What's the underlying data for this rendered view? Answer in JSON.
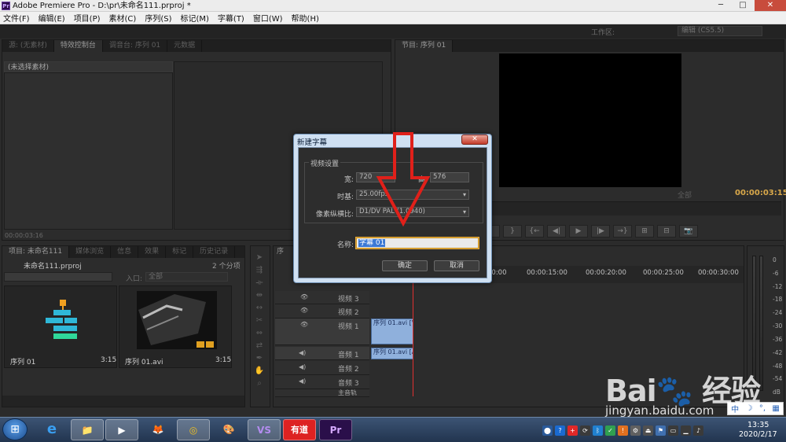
{
  "window": {
    "title": "Adobe Premiere Pro - D:\\pr\\未命名111.prproj *",
    "app_icon": "Pr",
    "minimize": "─",
    "maximize": "□",
    "close": "✕"
  },
  "menubar": {
    "items": [
      "文件(F)",
      "编辑(E)",
      "项目(P)",
      "素材(C)",
      "序列(S)",
      "标记(M)",
      "字幕(T)",
      "窗口(W)",
      "帮助(H)"
    ]
  },
  "workspace": {
    "label": "工作区:",
    "value": "编辑 (CS5.5)"
  },
  "source_panel": {
    "tabs": [
      "源: (无素材)",
      "特效控制台",
      "调音台: 序列 01",
      "元数据"
    ],
    "header": "(未选择素材)",
    "timecode": "00:00:03:16"
  },
  "program_panel": {
    "tab": "节目: 序列 01",
    "fit": "全部",
    "timecode": "00:00:03:15",
    "transport": [
      "{",
      "}",
      "{←",
      "◀|",
      "▶",
      "|▶",
      "→}",
      "⊞",
      "⊟",
      "📷"
    ]
  },
  "project_panel": {
    "tabs": [
      "项目: 未命名111",
      "媒体浏览",
      "信息",
      "效果",
      "标记",
      "历史记录"
    ],
    "name": "未命名111.prproj",
    "count": "2 个分项",
    "entry_label": "入口:",
    "entry_value": "全部",
    "items": [
      {
        "name": "序列 01",
        "duration": "3:15"
      },
      {
        "name": "序列 01.avi",
        "duration": "3:15"
      }
    ]
  },
  "timeline": {
    "tab": "序",
    "timecodes": [
      "00:00",
      "00:00:15:00",
      "00:00:20:00",
      "00:00:25:00",
      "00:00:30:00"
    ],
    "tracks": [
      {
        "name": "视频 3"
      },
      {
        "name": "视频 2"
      },
      {
        "name": "视频 1",
        "clip": "序列 01.avi [V]"
      },
      {
        "name": "音频 1",
        "clip": "序列 01.avi [A]"
      },
      {
        "name": "音频 2"
      },
      {
        "name": "音频 3"
      },
      {
        "name": "主音轨"
      }
    ]
  },
  "meter": {
    "labels": [
      "0",
      "-6",
      "-12",
      "-18",
      "-24",
      "-30",
      "-36",
      "-42",
      "-48",
      "-54",
      "dB"
    ]
  },
  "dialog": {
    "title": "新建字幕",
    "group_label": "视频设置",
    "width_label": "宽:",
    "width_value": "720",
    "height_label": "高:",
    "height_value": "576",
    "timebase_label": "时基:",
    "timebase_value": "25.00fps",
    "par_label": "像素纵横比:",
    "par_value": "D1/DV PAL (1.0940)",
    "name_label": "名称:",
    "name_value": "字幕 01",
    "ok": "确定",
    "cancel": "取消"
  },
  "taskbar": {
    "apps": [
      "e",
      "📁",
      "▶",
      "🦊",
      "◎",
      "🎨",
      "VS",
      "有道",
      "Pr"
    ],
    "time": "13:35",
    "date": "2020/2/17"
  },
  "ime": {
    "label": "中",
    "moon": "☽",
    "punct": "°,",
    "grid": "▦"
  },
  "watermark": {
    "logo": "Bai🐾 经验",
    "url": "jingyan.baidu.com"
  },
  "colors": {
    "accent": "#d9a84a",
    "playhead": "#e03030",
    "clip": "#8fb0dc",
    "dialog_frame": "#cfe0f2"
  }
}
